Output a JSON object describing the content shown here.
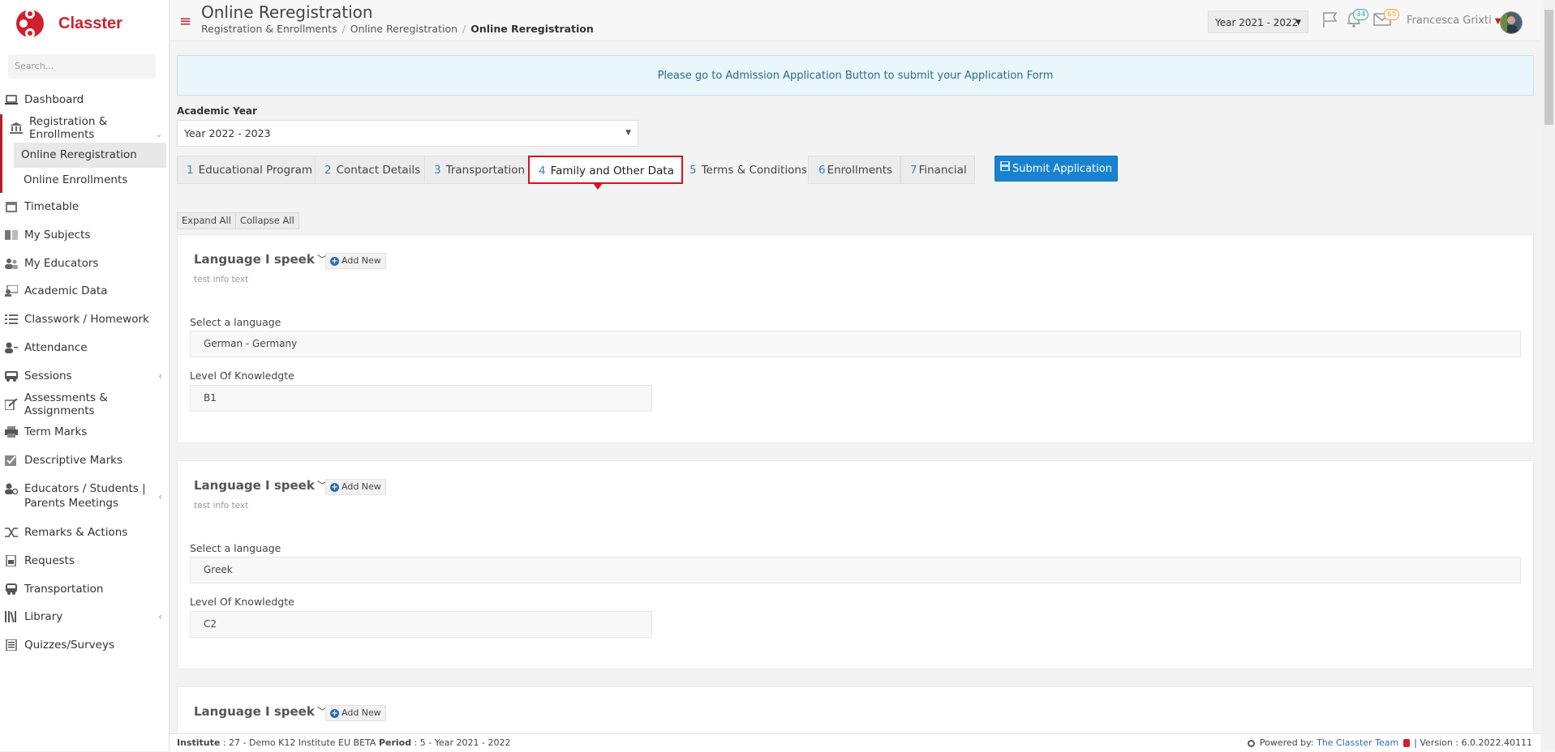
{
  "app": {
    "name": "Classter"
  },
  "search": {
    "placeholder": "Search..."
  },
  "sidebar": {
    "items": [
      {
        "label": "Dashboard",
        "icon": "laptop-icon"
      },
      {
        "label": "Registration & Enrollments",
        "icon": "bank-icon"
      },
      {
        "label": "Online Reregistration"
      },
      {
        "label": "Online Enrollments"
      },
      {
        "label": "Timetable",
        "icon": "calendar-icon"
      },
      {
        "label": "My Subjects",
        "icon": "book-icon"
      },
      {
        "label": "My Educators",
        "icon": "users-icon"
      },
      {
        "label": "Academic Data",
        "icon": "academic-icon"
      },
      {
        "label": "Classwork / Homework",
        "icon": "list-icon"
      },
      {
        "label": "Attendance",
        "icon": "attendance-icon"
      },
      {
        "label": "Sessions",
        "icon": "bus-icon"
      },
      {
        "label": "Assessments & Assignments",
        "icon": "edit-icon"
      },
      {
        "label": "Term Marks",
        "icon": "print-icon"
      },
      {
        "label": "Descriptive Marks",
        "icon": "check-icon"
      },
      {
        "label": "Educators / Students | Parents Meetings",
        "icon": "meeting-icon"
      },
      {
        "label": "Remarks & Actions",
        "icon": "shuffle-icon"
      },
      {
        "label": "Requests",
        "icon": "file-icon"
      },
      {
        "label": "Transportation",
        "icon": "bus-icon"
      },
      {
        "label": "Library",
        "icon": "library-icon"
      },
      {
        "label": "Quizzes/Surveys",
        "icon": "quiz-icon"
      }
    ]
  },
  "header": {
    "title": "Online Reregistration",
    "breadcrumb": [
      "Registration & Enrollments",
      "Online Reregistration",
      "Online Reregistration"
    ],
    "year": "Year 2021 - 2022",
    "notifications": "34",
    "messages": "65",
    "user": "Francesca Grixti"
  },
  "info": "Please go to Admission Application Button to submit your Application Form",
  "academic_year": {
    "label": "Academic Year",
    "value": "Year 2022 - 2023"
  },
  "tabs": [
    {
      "num": "1",
      "label": "Educational Program"
    },
    {
      "num": "2",
      "label": "Contact Details"
    },
    {
      "num": "3",
      "label": "Transportation"
    },
    {
      "num": "4",
      "label": "Family and Other Data"
    },
    {
      "num": "5",
      "label": "Terms & Conditions"
    },
    {
      "num": "6",
      "label": "Enrollments"
    },
    {
      "num": "7",
      "label": "Financial"
    }
  ],
  "submit_label": "Submit Application",
  "expand_all": "Expand All",
  "collapse_all": "Collapse All",
  "sections": [
    {
      "title": "Language I speek",
      "add": "Add New",
      "info": "test info text",
      "lang_label": "Select a language",
      "lang_value": "German - Germany",
      "level_label": "Level Of Knowledgte",
      "level_value": "B1"
    },
    {
      "title": "Language I speek",
      "add": "Add New",
      "info": "test info text",
      "lang_label": "Select a language",
      "lang_value": "Greek",
      "level_label": "Level Of Knowledgte",
      "level_value": "C2"
    },
    {
      "title": "Language I speek",
      "add": "Add New"
    }
  ],
  "footer": {
    "institute_label": "Institute",
    "institute": ": 27 - Demo K12 Institute EU BETA",
    "period_label": "Period",
    "period": ": 5 - Year 2021 - 2022",
    "powered": "Powered by:",
    "team": "The Classter Team",
    "version": "| Version : 6.0.2022.40111"
  },
  "colors": {
    "brand": "#d0202f",
    "active_tab_border": "#d6101f",
    "submit": "#1982d0"
  }
}
